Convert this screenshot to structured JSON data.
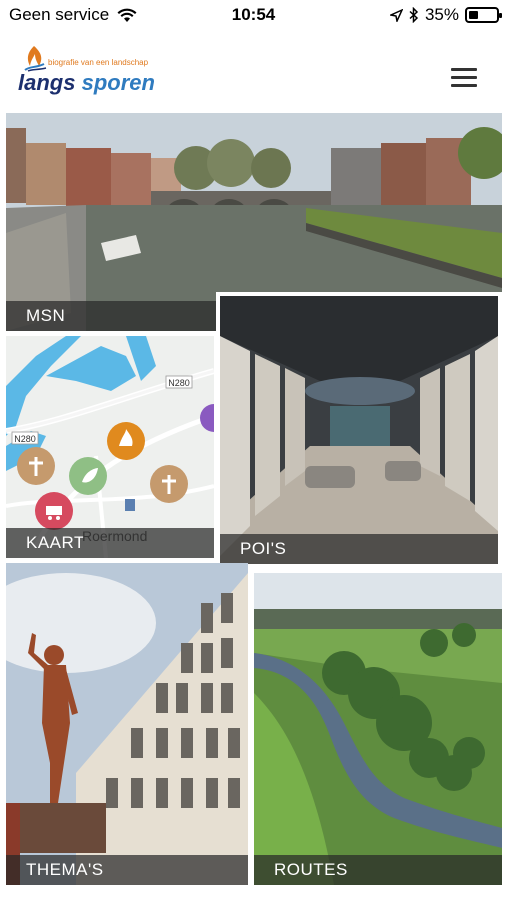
{
  "status": {
    "carrier": "Geen service",
    "time": "10:54",
    "battery": "35%",
    "battery_level": 0.35
  },
  "header": {
    "logo_tagline": "biografie van een landschap",
    "logo_word1": "langs",
    "logo_word2": "sporen"
  },
  "tiles": {
    "msn": "MSN",
    "kaart": "KAART",
    "pois": "POI'S",
    "themas": "THEMA'S",
    "routes": "ROUTES"
  },
  "map": {
    "road_label_1": "N280",
    "road_label_2": "N280",
    "city_label": "Roermond"
  },
  "colors": {
    "logo_orange": "#e07a1f",
    "logo_dark_blue": "#1c2f6e",
    "logo_blue": "#2f7bbf",
    "map_water": "#5bb8e6",
    "pin_brown": "#c59a6d",
    "pin_green": "#8fbf85",
    "pin_orange": "#e08a1e",
    "pin_red": "#d64a5f"
  }
}
